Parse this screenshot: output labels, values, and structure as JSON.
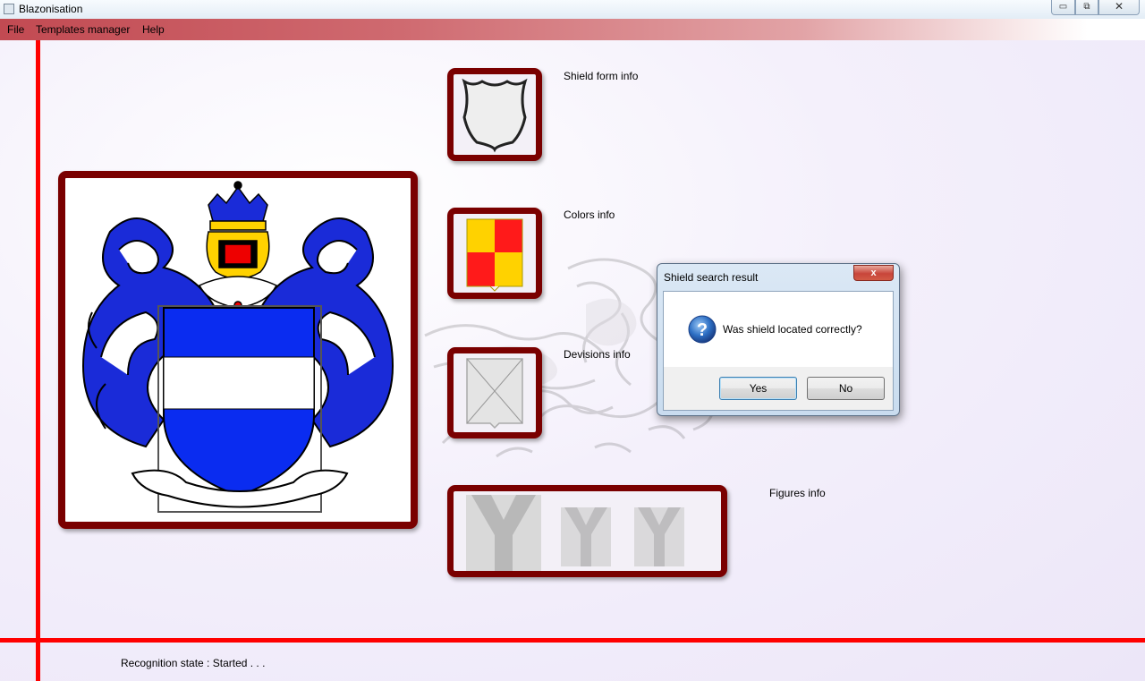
{
  "window": {
    "title": "Blazonisation",
    "controls": {
      "minimize": "▭",
      "maximize": "⧉",
      "close": "✕"
    }
  },
  "menu": {
    "items": [
      {
        "label": "File"
      },
      {
        "label": "Templates manager"
      },
      {
        "label": "Help"
      }
    ]
  },
  "panels": {
    "shield_form_label": "Shield form info",
    "colors_label": "Colors info",
    "devisions_label": "Devisions info",
    "figures_label": "Figures info"
  },
  "status": {
    "text": "Recognition state : Started . . ."
  },
  "dialog": {
    "title": "Shield search result",
    "close_glyph": "x",
    "message": "Was shield located correctly?",
    "yes_label": "Yes",
    "no_label": "No",
    "icon": "question-icon"
  },
  "colors": {
    "accent_red": "#ff0000",
    "frame_dark_red": "#7a0000",
    "shield_blue": "#0a2cf0",
    "color_yellow": "#ffd200",
    "color_red": "#ff1a1a"
  }
}
